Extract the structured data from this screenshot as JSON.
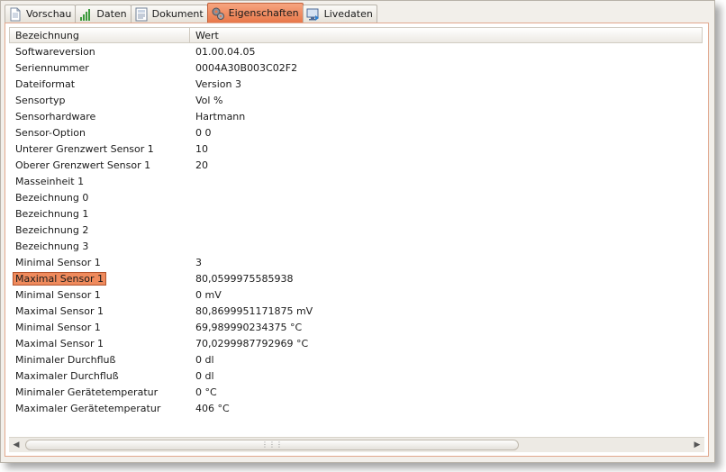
{
  "tabs": [
    {
      "label": "Vorschau",
      "icon": "document-icon",
      "active": false
    },
    {
      "label": "Daten",
      "icon": "bar-chart-icon",
      "active": false
    },
    {
      "label": "Dokument",
      "icon": "form-icon",
      "active": false
    },
    {
      "label": "Eigenschaften",
      "icon": "gears-icon",
      "active": true
    },
    {
      "label": "Livedaten",
      "icon": "monitor-icon",
      "active": false
    }
  ],
  "table": {
    "columns": [
      "Bezeichnung",
      "Wert"
    ],
    "rows": [
      {
        "name": "Softwareversion",
        "value": "01.00.04.05"
      },
      {
        "name": "Seriennummer",
        "value": "0004A30B003C02F2"
      },
      {
        "name": "Dateiformat",
        "value": "Version 3"
      },
      {
        "name": "Sensortyp",
        "value": "Vol %"
      },
      {
        "name": "Sensorhardware",
        "value": "Hartmann"
      },
      {
        "name": "Sensor-Option",
        "value": "0 0"
      },
      {
        "name": "Unterer Grenzwert Sensor 1",
        "value": "10"
      },
      {
        "name": "Oberer Grenzwert Sensor 1",
        "value": "20"
      },
      {
        "name": "Masseinheit 1",
        "value": ""
      },
      {
        "name": "Bezeichnung 0",
        "value": ""
      },
      {
        "name": "Bezeichnung 1",
        "value": ""
      },
      {
        "name": "Bezeichnung 2",
        "value": ""
      },
      {
        "name": "Bezeichnung 3",
        "value": ""
      },
      {
        "name": "Minimal Sensor 1",
        "value": "3"
      },
      {
        "name": "Maximal Sensor 1",
        "value": "80,0599975585938",
        "selected": true
      },
      {
        "name": "Minimal Sensor 1",
        "value": "0  mV"
      },
      {
        "name": "Maximal Sensor 1",
        "value": "80,8699951171875  mV"
      },
      {
        "name": "Minimal Sensor 1",
        "value": "69,989990234375  °C"
      },
      {
        "name": "Maximal Sensor 1",
        "value": "70,0299987792969  °C"
      },
      {
        "name": "Minimaler Durchfluß",
        "value": "0  dl"
      },
      {
        "name": "Maximaler Durchfluß",
        "value": "0  dl"
      },
      {
        "name": "Minimaler Gerätetemperatur",
        "value": "0  °C"
      },
      {
        "name": "Maximaler Gerätetemperatur",
        "value": "406  °C"
      }
    ]
  },
  "scrollbar": {
    "grip": "⋮⋮⋮"
  },
  "colors": {
    "accent": "#ef8a5c",
    "panel_border": "#e1a88e"
  }
}
